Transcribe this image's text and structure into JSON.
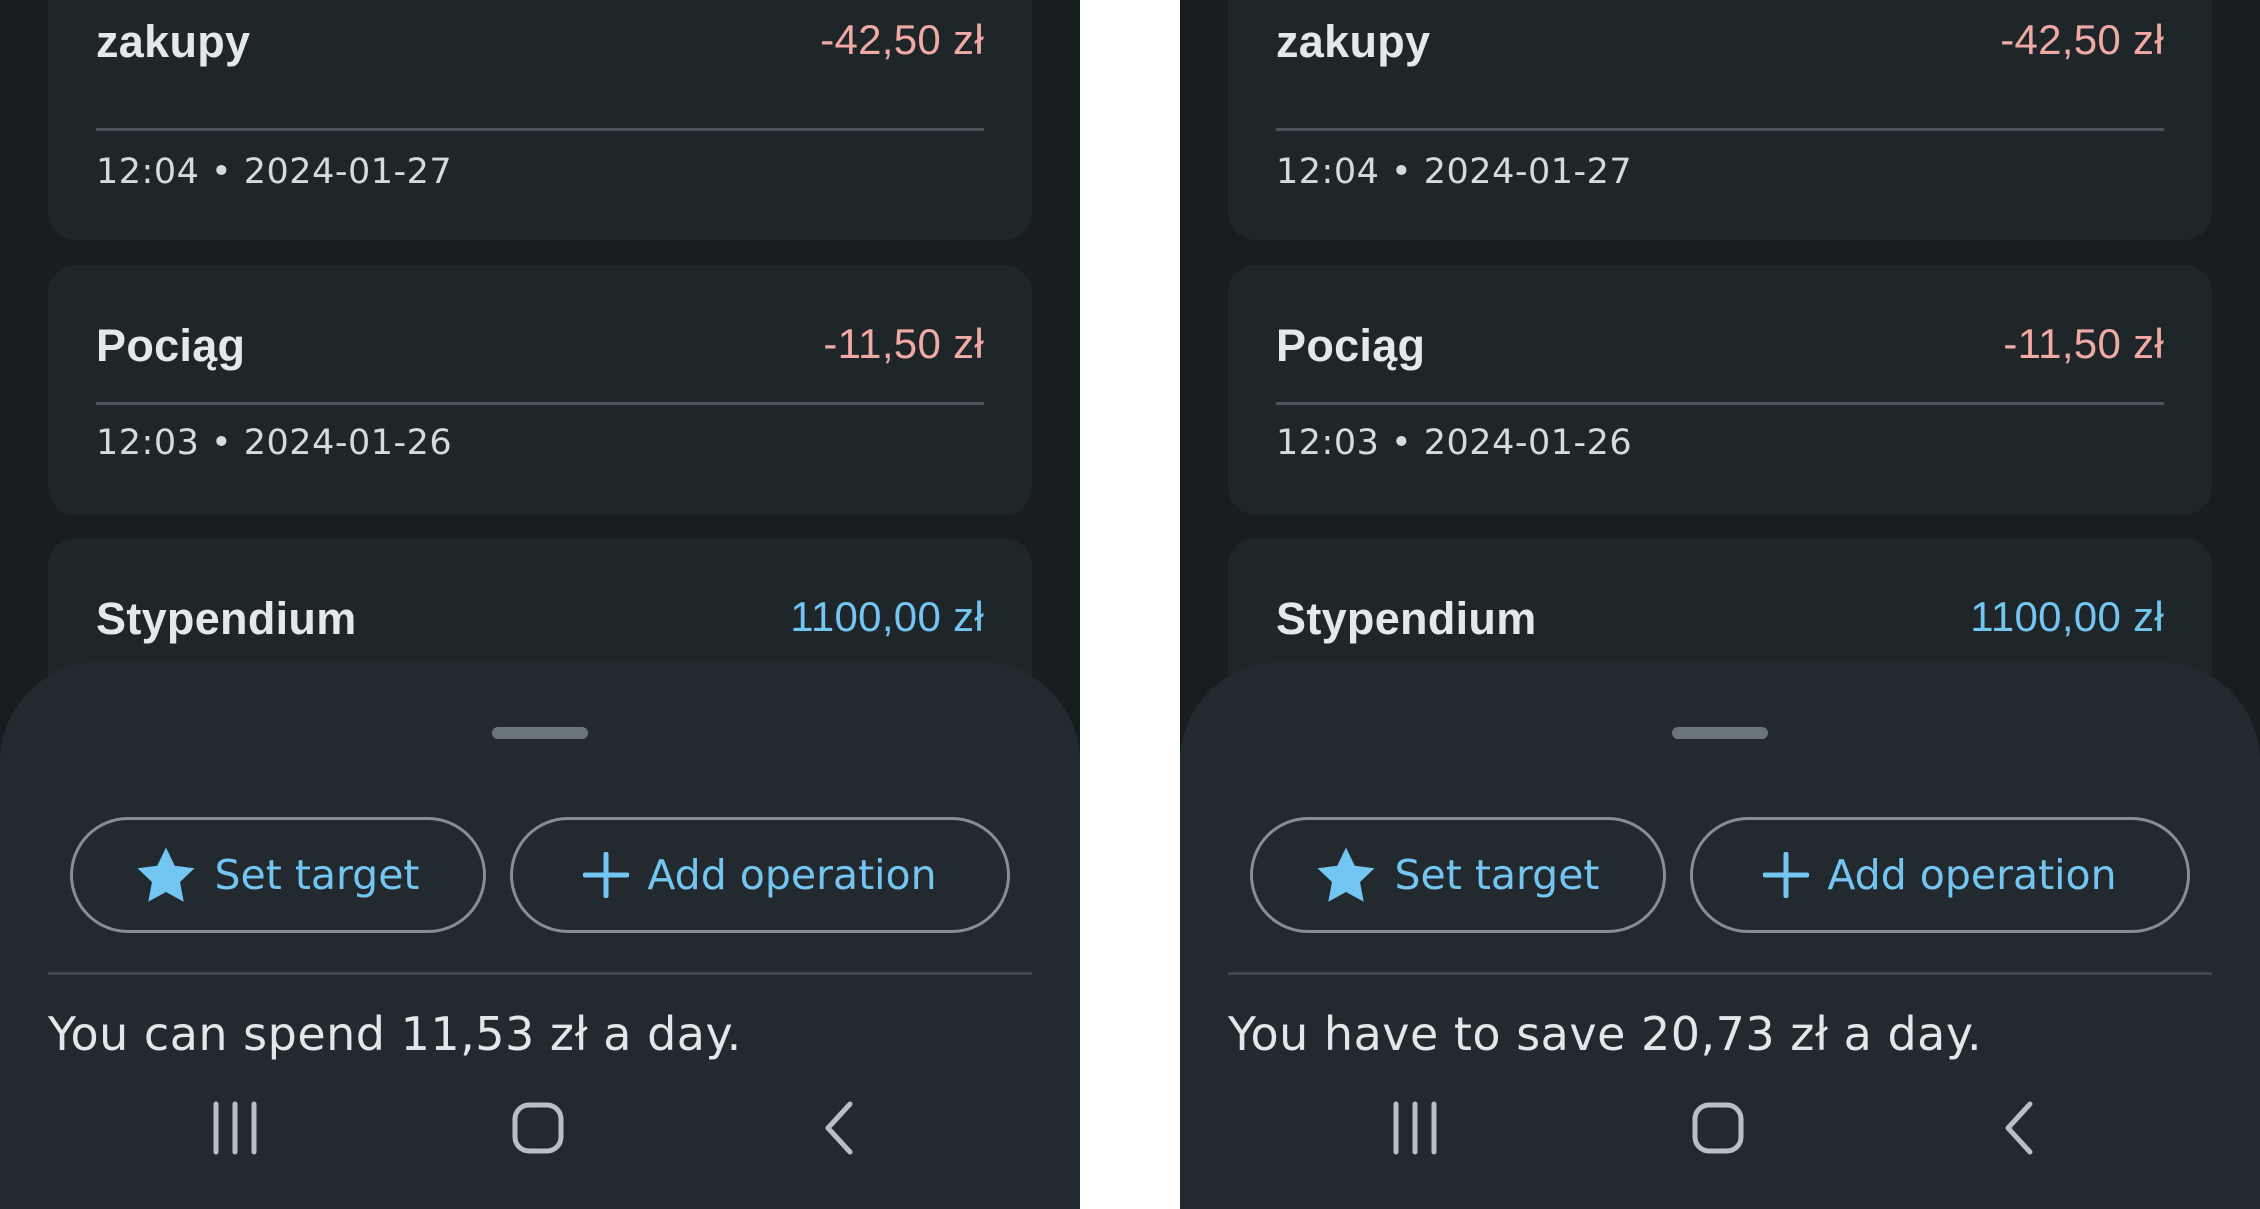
{
  "colors": {
    "background": "#181d20",
    "card": "#1f262a",
    "sheet": "#222a2f",
    "accent": "#74c6f2",
    "negative_amount": "#f0a9a3",
    "positive_amount": "#74c6f2"
  },
  "screens": [
    {
      "transactions": [
        {
          "title": "zakupy",
          "amount": "-42,50 zł",
          "type": "expense",
          "meta": "12:04 • 2024-01-27"
        },
        {
          "title": "Pociąg",
          "amount": "-11,50 zł",
          "type": "expense",
          "meta": "12:03 • 2024-01-26"
        },
        {
          "title": "Stypendium",
          "amount": "1100,00 zł",
          "type": "income",
          "meta": ""
        }
      ],
      "sheet": {
        "set_target_label": "Set target",
        "set_target_icon": "star-icon",
        "add_operation_label": "Add operation",
        "add_operation_icon": "plus-icon",
        "daily_text": "You can spend 11,53 zł a day."
      },
      "navbar": [
        "recent-apps-icon",
        "home-icon",
        "back-icon"
      ]
    },
    {
      "transactions": [
        {
          "title": "zakupy",
          "amount": "-42,50 zł",
          "type": "expense",
          "meta": "12:04 • 2024-01-27"
        },
        {
          "title": "Pociąg",
          "amount": "-11,50 zł",
          "type": "expense",
          "meta": "12:03 • 2024-01-26"
        },
        {
          "title": "Stypendium",
          "amount": "1100,00 zł",
          "type": "income",
          "meta": ""
        }
      ],
      "sheet": {
        "set_target_label": "Set target",
        "set_target_icon": "star-icon",
        "add_operation_label": "Add operation",
        "add_operation_icon": "plus-icon",
        "daily_text": "You have to save 20,73 zł a day."
      },
      "navbar": [
        "recent-apps-icon",
        "home-icon",
        "back-icon"
      ]
    }
  ]
}
